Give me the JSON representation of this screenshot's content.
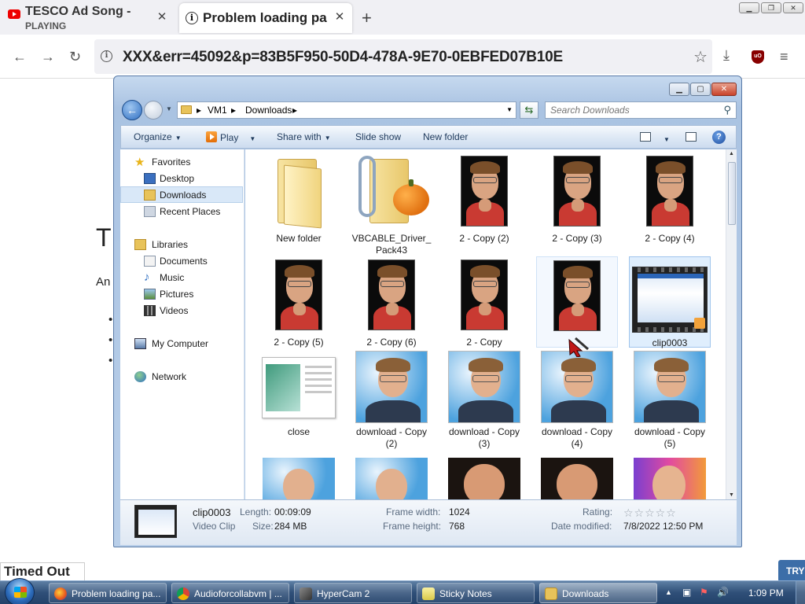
{
  "browser": {
    "tabs": [
      {
        "title": "TESCO Ad Song -",
        "status": "PLAYING"
      },
      {
        "title": "Problem loading pa"
      }
    ],
    "url": "XXX&err=45092&p=83B5F950-50D4-478A-9E70-0EBFED07B10E"
  },
  "background_page": {
    "heading_letter": "T",
    "line_start": "An",
    "bullets": [
      "•",
      "•",
      "•"
    ],
    "status_text": "Timed Out",
    "try_label": "TRY"
  },
  "explorer": {
    "breadcrumb": [
      "VM1",
      "Downloads"
    ],
    "search_placeholder": "Search Downloads",
    "commands": {
      "organize": "Organize",
      "play": "Play",
      "share": "Share with",
      "slideshow": "Slide show",
      "new_folder": "New folder"
    },
    "nav": {
      "favorites": "Favorites",
      "desktop": "Desktop",
      "downloads": "Downloads",
      "recent": "Recent Places",
      "libraries": "Libraries",
      "documents": "Documents",
      "music": "Music",
      "pictures": "Pictures",
      "videos": "Videos",
      "computer": "My Computer",
      "network": "Network"
    },
    "files": [
      {
        "name": "New folder",
        "kind": "folder"
      },
      {
        "name": "VBCABLE_Driver_ Pack43",
        "kind": "zip"
      },
      {
        "name": "2 - Copy (2)",
        "kind": "photo-dark"
      },
      {
        "name": "2 - Copy (3)",
        "kind": "photo-dark"
      },
      {
        "name": "2 - Copy (4)",
        "kind": "photo-dark"
      },
      {
        "name": "2 - Copy (5)",
        "kind": "photo-dark"
      },
      {
        "name": "2 - Copy (6)",
        "kind": "photo-dark"
      },
      {
        "name": "2 - Copy",
        "kind": "photo-dark"
      },
      {
        "name": "",
        "kind": "photo-dark"
      },
      {
        "name": "clip0003",
        "kind": "video"
      },
      {
        "name": "close",
        "kind": "doc"
      },
      {
        "name": "download - Copy (2)",
        "kind": "photo-blue"
      },
      {
        "name": "download - Copy (3)",
        "kind": "photo-blue"
      },
      {
        "name": "download - Copy (4)",
        "kind": "photo-blue"
      },
      {
        "name": "download - Copy (5)",
        "kind": "photo-blue"
      }
    ],
    "details": {
      "name": "clip0003",
      "type": "Video Clip",
      "length_label": "Length:",
      "length": "00:09:09",
      "size_label": "Size:",
      "size": "284 MB",
      "fw_label": "Frame width:",
      "frame_width": "1024",
      "fh_label": "Frame height:",
      "frame_height": "768",
      "rating_label": "Rating:",
      "rating_stars": "☆☆☆☆☆",
      "date_label": "Date modified:",
      "date_modified": "7/8/2022 12:50 PM"
    }
  },
  "taskbar": {
    "buttons": [
      {
        "label": "Problem loading pa..."
      },
      {
        "label": "Audioforcollabvm | ..."
      },
      {
        "label": "HyperCam 2"
      },
      {
        "label": "Sticky Notes"
      },
      {
        "label": "Downloads"
      }
    ],
    "clock": "1:09 PM"
  }
}
